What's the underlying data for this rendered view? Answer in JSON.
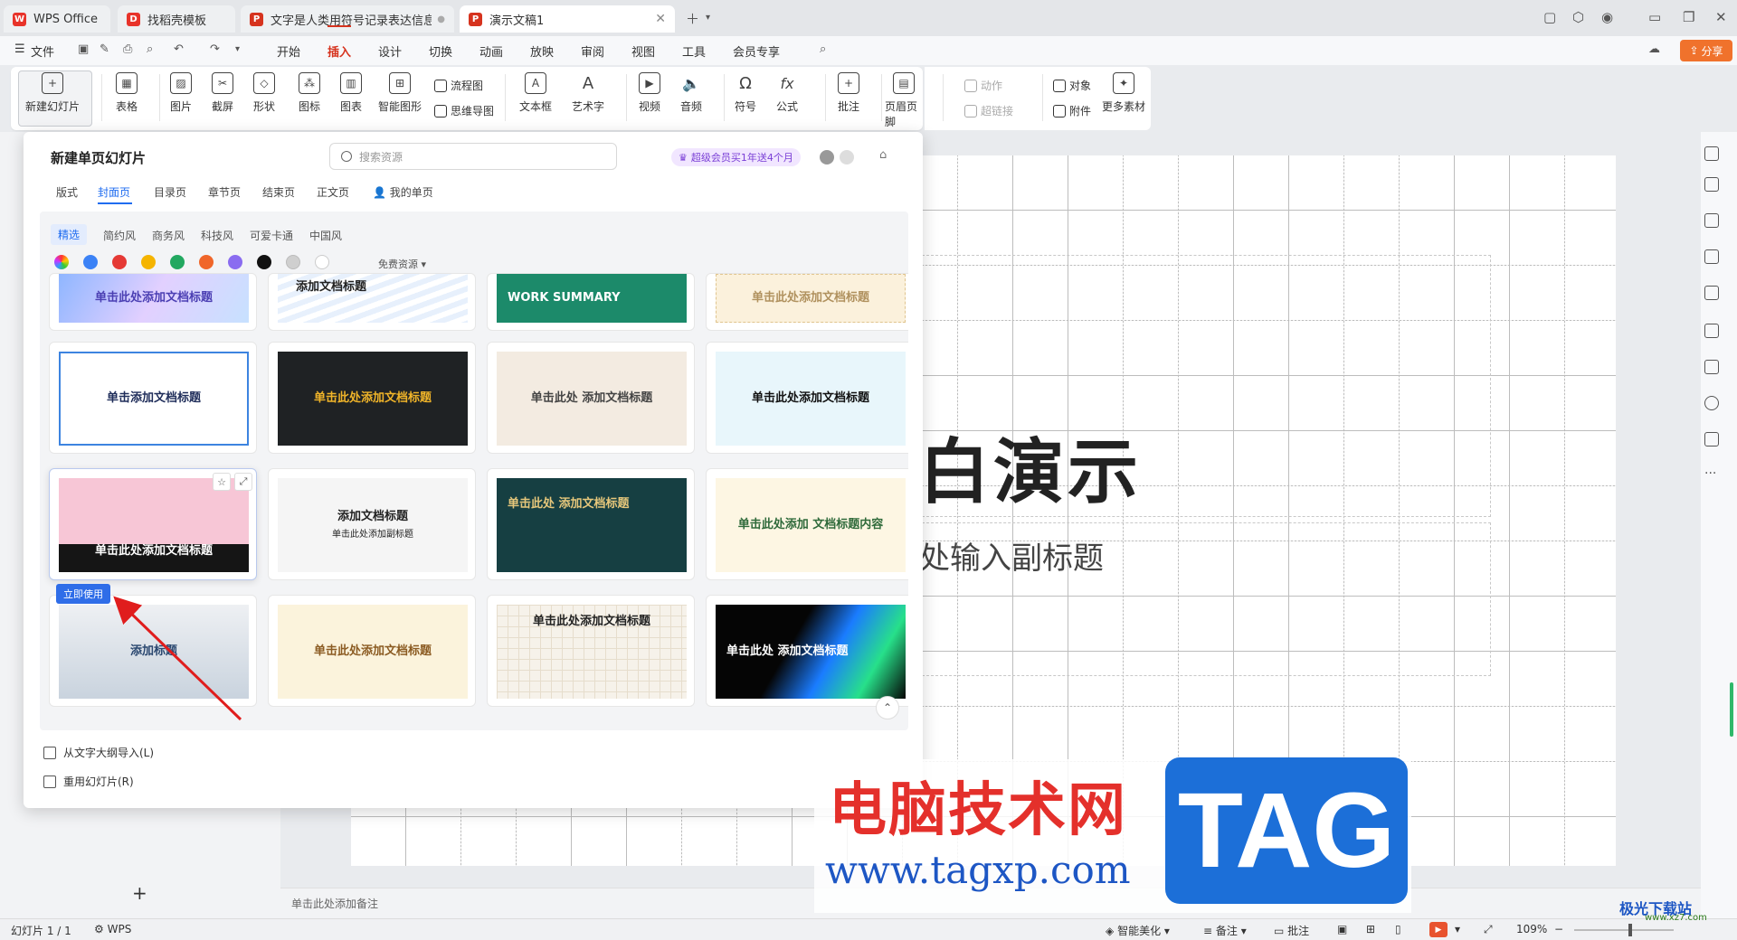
{
  "tabs": [
    {
      "label": "WPS Office",
      "icon": "wps-logo-icon",
      "color": "#e8332a"
    },
    {
      "label": "找稻壳模板",
      "icon": "docer-icon",
      "color": "#e8332a"
    },
    {
      "label": "文字是人类用符号记录表达信息以",
      "icon": "ppt-icon",
      "color": "#d6331e"
    },
    {
      "label": "演示文稿1",
      "icon": "ppt-icon",
      "color": "#d6331e"
    }
  ],
  "menubar": {
    "file": "文件",
    "items": [
      "开始",
      "插入",
      "设计",
      "切换",
      "动画",
      "放映",
      "审阅",
      "视图",
      "工具",
      "会员专享"
    ],
    "active": "插入",
    "share": "分享"
  },
  "ribbon": {
    "new_slide": "新建幻灯片",
    "table": "表格",
    "picture": "图片",
    "screenshot": "截屏",
    "shape": "形状",
    "icon": "图标",
    "chart": "图表",
    "smart_graphic": "智能图形",
    "flowchart": "流程图",
    "mindmap": "思维导图",
    "textbox": "文本框",
    "wordart": "艺术字",
    "video": "视频",
    "audio": "音频",
    "symbol": "符号",
    "formula": "公式",
    "comment": "批注",
    "header_footer": "页眉页脚",
    "action": "动作",
    "hyperlink": "超链接",
    "object": "对象",
    "attachment": "附件",
    "more_material": "更多素材"
  },
  "panel": {
    "title": "新建单页幻灯片",
    "search_placeholder": "搜索资源",
    "vip_badge": "超级会员买1年送4个月",
    "categories": [
      "版式",
      "封面页",
      "目录页",
      "章节页",
      "结束页",
      "正文页",
      "我的单页"
    ],
    "active_category": "封面页",
    "styles": [
      "精选",
      "简约风",
      "商务风",
      "科技风",
      "可爱卡通",
      "中国风"
    ],
    "active_style": "精选",
    "swatches": [
      "#3b82f6",
      "#e53935",
      "#f5b400",
      "#22a860",
      "#f0662a",
      "#8a6cf0",
      "#111111",
      "#cfcfcf",
      "#ffffff"
    ],
    "free_filter": "免费资源",
    "use_now": "立即使用",
    "import_outline": "从文字大纲导入(L)",
    "reuse_slides": "重用幻灯片(R)",
    "templates": [
      {
        "title": "单击此处添加文档标题"
      },
      {
        "title": "添加文档标题"
      },
      {
        "title": "WORK SUMMARY"
      },
      {
        "title": "单击此处添加文档标题"
      },
      {
        "title": "单击添加文档标题"
      },
      {
        "title": "单击此处添加文档标题"
      },
      {
        "title": "单击此处 添加文档标题"
      },
      {
        "title": "单击此处添加文档标题"
      },
      {
        "title": "单击此处添加文档标题"
      },
      {
        "title": "添加文档标题",
        "subtitle": "单击此处添加副标题"
      },
      {
        "title": "单击此处 添加文档标题"
      },
      {
        "title": "单击此处添加 文档标题内容"
      },
      {
        "title": "添加标题"
      },
      {
        "title": "单击此处添加文档标题"
      },
      {
        "title": "单击此处添加文档标题"
      },
      {
        "title": "单击此处 添加文档标题"
      }
    ]
  },
  "slide": {
    "title_partial": "白演示",
    "subtitle_partial": "处输入副标题"
  },
  "notes_placeholder": "单击此处添加备注",
  "statusbar": {
    "slide_info": "幻灯片 1 / 1",
    "theme": "WPS",
    "smart_beautify": "智能美化",
    "notes": "备注",
    "comments": "批注",
    "zoom": "109%"
  },
  "watermark": {
    "site_name": "电脑技术网",
    "url": "www.tagxp.com",
    "tag": "TAG",
    "corner": "极光下载站",
    "corner_url": "www.xz7.com"
  },
  "colors": {
    "accent_red": "#d6331e",
    "share_orange": "#f0722c",
    "link_blue": "#1f6cf0"
  }
}
